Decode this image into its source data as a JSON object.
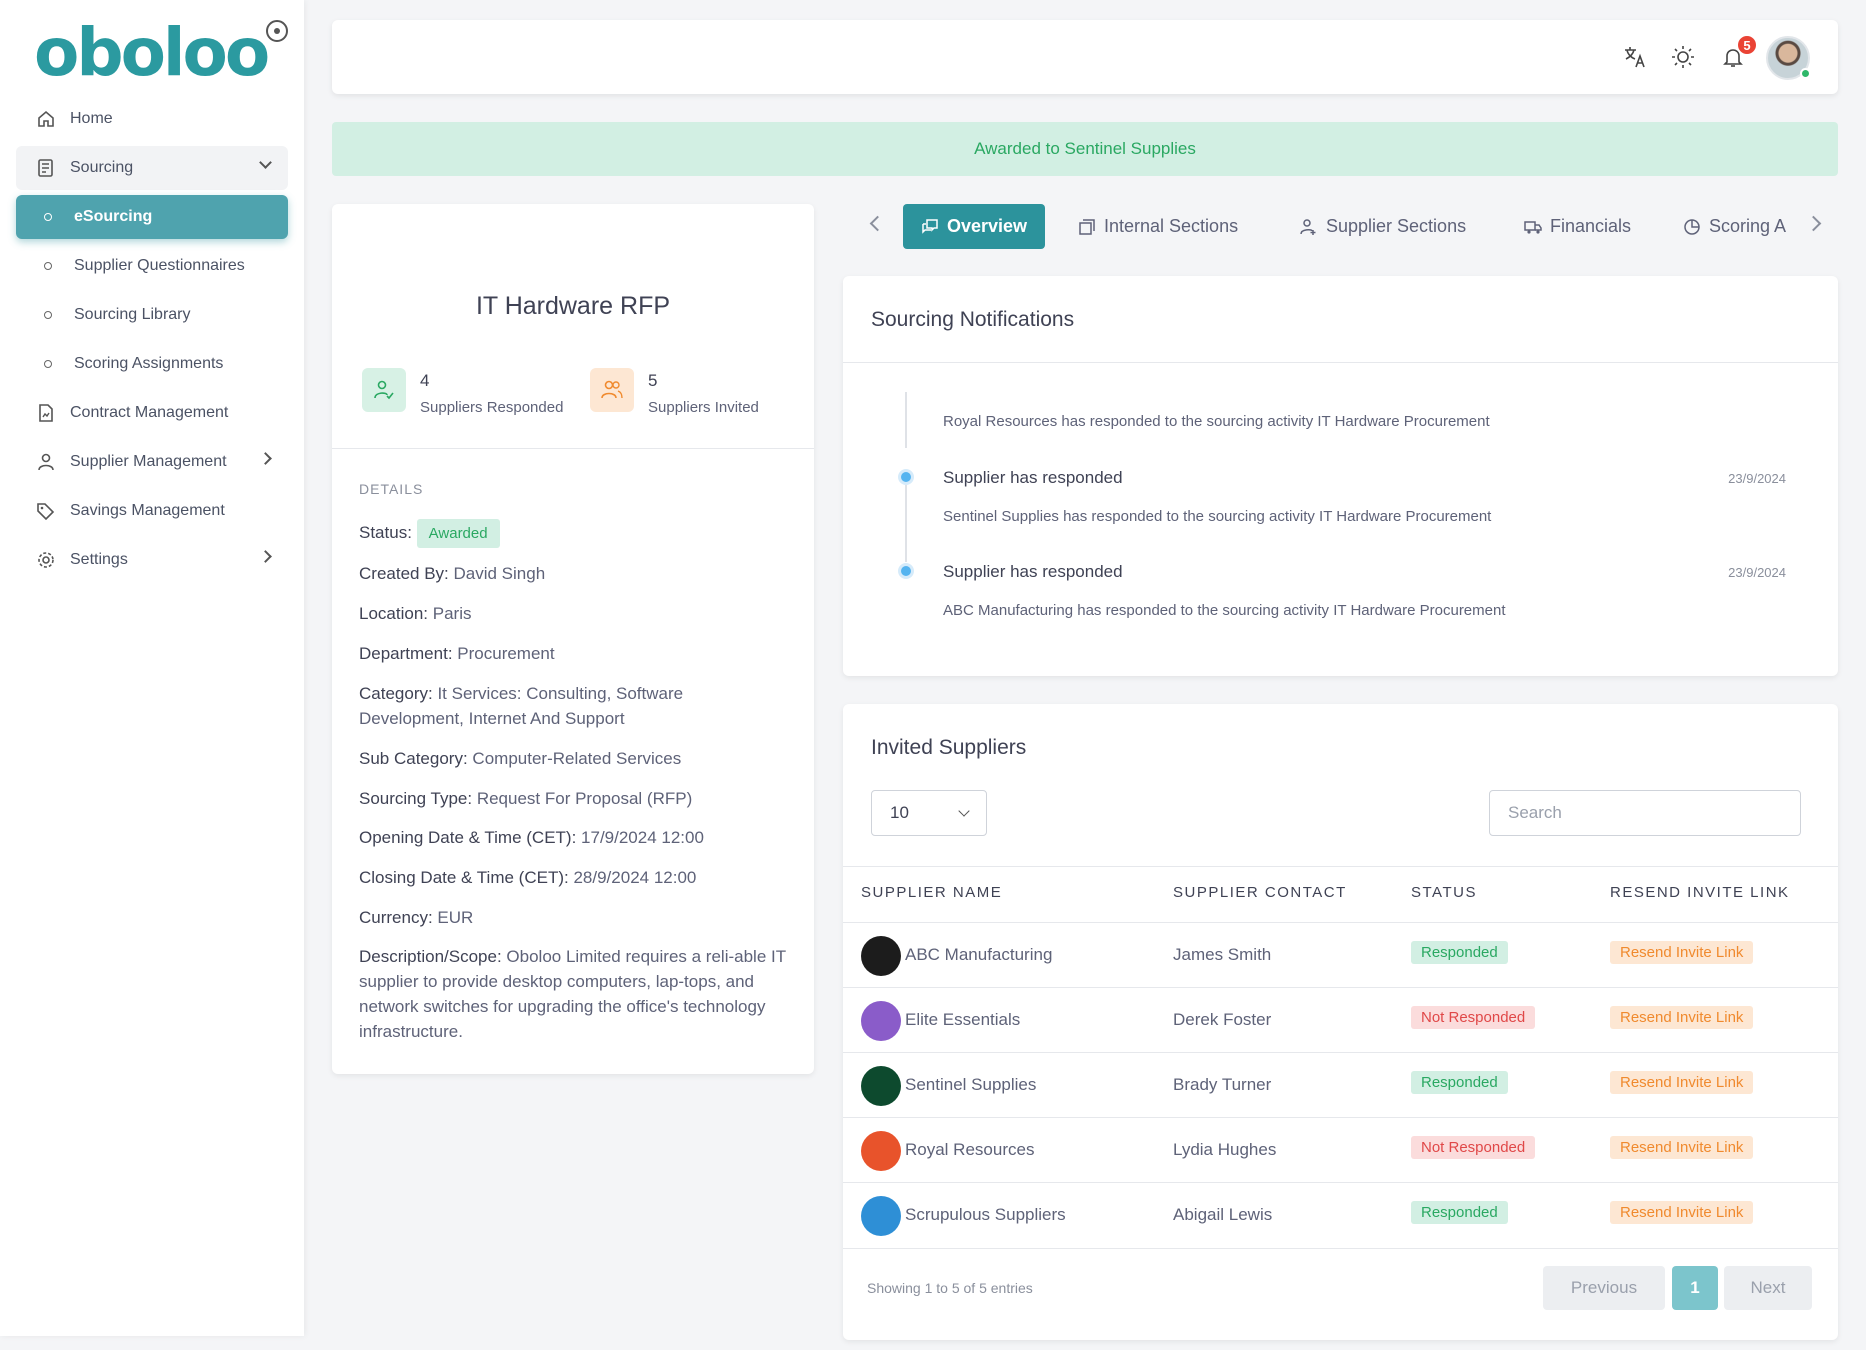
{
  "brand": {
    "name": "oboloo",
    "color": "#2b9aa0"
  },
  "sidebar": {
    "items": [
      {
        "label": "Home",
        "icon": "home-icon"
      },
      {
        "label": "Sourcing",
        "icon": "document-list-icon"
      },
      {
        "label": "eSourcing"
      },
      {
        "label": "Supplier Questionnaires"
      },
      {
        "label": "Sourcing Library"
      },
      {
        "label": "Scoring Assignments"
      },
      {
        "label": "Contract Management",
        "icon": "contract-icon"
      },
      {
        "label": "Supplier Management",
        "icon": "user-icon"
      },
      {
        "label": "Savings Management",
        "icon": "tag-icon"
      },
      {
        "label": "Settings",
        "icon": "gear-icon"
      }
    ]
  },
  "header": {
    "notification_count": "5"
  },
  "banner": {
    "text": "Awarded to Sentinel Supplies"
  },
  "project": {
    "title": "IT Hardware RFP",
    "responded_count": "4",
    "responded_label": "Suppliers Responded",
    "invited_count": "5",
    "invited_label": "Suppliers Invited",
    "details_heading": "DETAILS",
    "status_label": "Status:",
    "status_value": "Awarded",
    "details": [
      {
        "label": "Created By:",
        "value": "David Singh"
      },
      {
        "label": "Location:",
        "value": "Paris"
      },
      {
        "label": "Department:",
        "value": "Procurement"
      },
      {
        "label": "Category:",
        "value": "It Services: Consulting, Software Development, Internet And Support"
      },
      {
        "label": "Sub Category:",
        "value": "Computer-Related Services"
      },
      {
        "label": "Sourcing Type:",
        "value": "Request For Proposal (RFP)"
      },
      {
        "label": "Opening Date & Time (CET):",
        "value": "17/9/2024 12:00"
      },
      {
        "label": "Closing Date & Time (CET):",
        "value": "28/9/2024 12:00"
      },
      {
        "label": "Currency:",
        "value": "EUR"
      },
      {
        "label": "Description/Scope:",
        "value": "Oboloo Limited requires a reli-able IT supplier to provide desktop computers, lap-tops, and network switches for upgrading the office's technology infrastructure."
      }
    ]
  },
  "tabs": [
    {
      "label": "Overview"
    },
    {
      "label": "Internal Sections"
    },
    {
      "label": "Supplier Sections"
    },
    {
      "label": "Financials"
    },
    {
      "label": "Scoring A"
    }
  ],
  "notifications": {
    "title": "Sourcing Notifications",
    "items": [
      {
        "title": "",
        "date": "",
        "text": "Royal Resources has responded to the sourcing activity IT Hardware Procurement"
      },
      {
        "title": "Supplier has responded",
        "date": "23/9/2024",
        "text": "Sentinel Supplies has responded to the sourcing activity IT Hardware Procurement"
      },
      {
        "title": "Supplier has responded",
        "date": "23/9/2024",
        "text": "ABC Manufacturing has responded to the sourcing activity IT Hardware Procurement"
      }
    ]
  },
  "suppliers": {
    "title": "Invited Suppliers",
    "page_size": "10",
    "search_placeholder": "Search",
    "columns": [
      "SUPPLIER NAME",
      "SUPPLIER CONTACT",
      "STATUS",
      "RESEND INVITE LINK"
    ],
    "rows": [
      {
        "name": "ABC Manufacturing",
        "contact": "James Smith",
        "status": "Responded",
        "resend": "Resend Invite Link",
        "logo_color": "#1c1c1c"
      },
      {
        "name": "Elite Essentials",
        "contact": "Derek Foster",
        "status": "Not Responded",
        "resend": "Resend Invite Link",
        "logo_color": "#8a5cc9"
      },
      {
        "name": "Sentinel Supplies",
        "contact": "Brady Turner",
        "status": "Responded",
        "resend": "Resend Invite Link",
        "logo_color": "#0d4a2e"
      },
      {
        "name": "Royal Resources",
        "contact": "Lydia Hughes",
        "status": "Not Responded",
        "resend": "Resend Invite Link",
        "logo_color": "#e8532b"
      },
      {
        "name": "Scrupulous Suppliers",
        "contact": "Abigail Lewis",
        "status": "Responded",
        "resend": "Resend Invite Link",
        "logo_color": "#2e8fd6"
      }
    ],
    "showing": "Showing 1 to 5 of 5 entries",
    "prev": "Previous",
    "page": "1",
    "next": "Next"
  }
}
